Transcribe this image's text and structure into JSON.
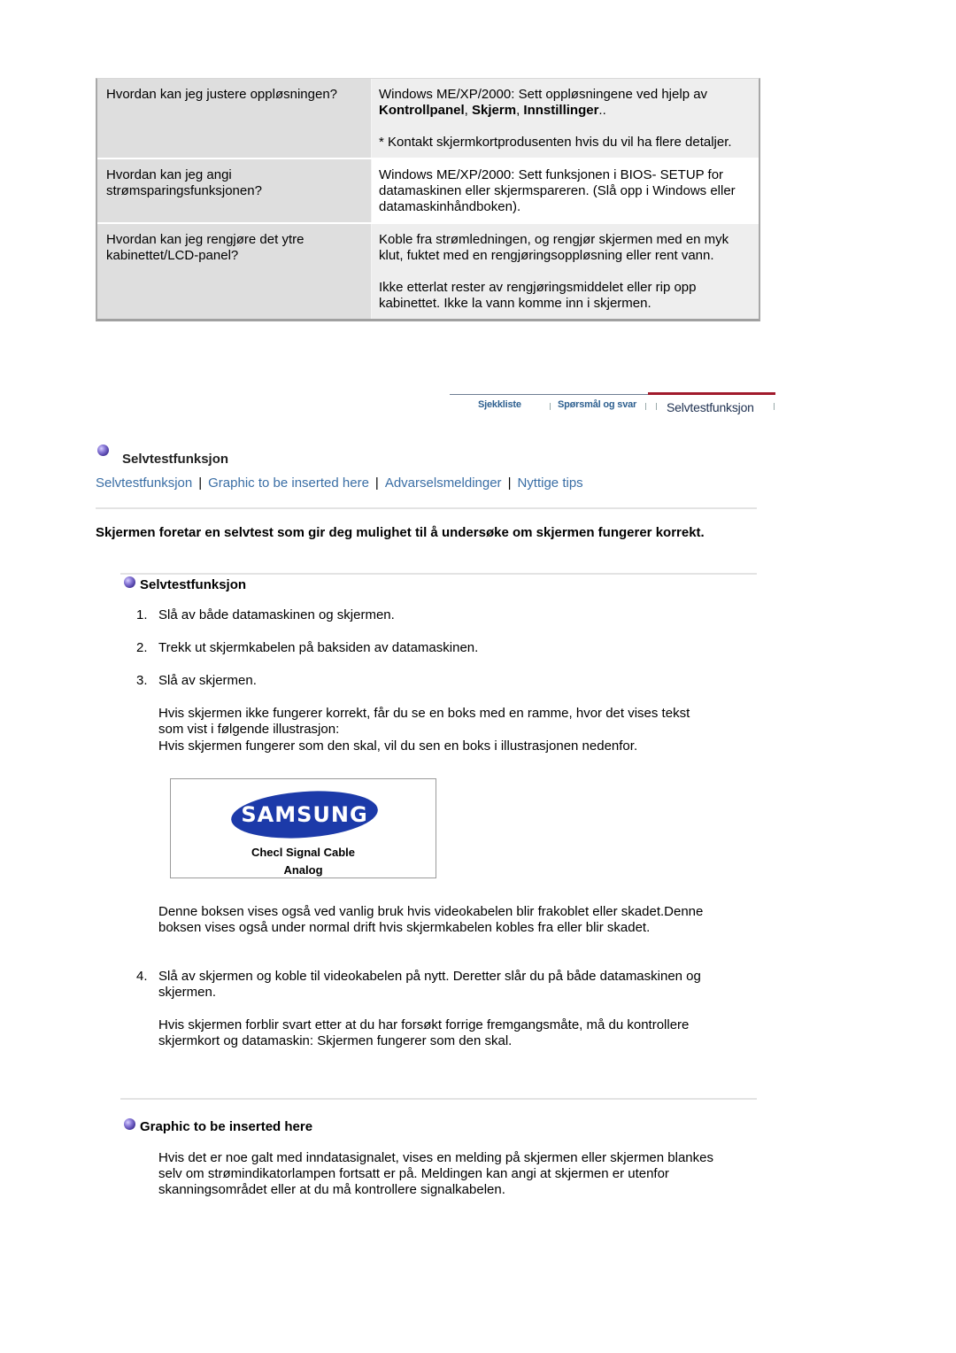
{
  "faq": [
    {
      "question": "Hvordan kan jeg justere oppløsningen?",
      "answer_prefix": "Windows ME/XP/2000: Sett oppløsningene ved hjelp av ",
      "answer_bold_1": "Kontrollpanel",
      "answer_sep_1": ", ",
      "answer_bold_2": "Skjerm",
      "answer_sep_2": ", ",
      "answer_bold_3": "Innstillinger",
      "answer_suffix": "..",
      "answer_note": "* Kontakt skjermkortprodusenten hvis du vil ha flere detaljer."
    },
    {
      "question": "Hvordan kan jeg angi strømsparingsfunksjonen?",
      "answer": "Windows ME/XP/2000: Sett funksjonen i BIOS- SETUP for datamaskinen eller skjermspareren. (Slå opp i Windows eller datamaskinhåndboken)."
    },
    {
      "question": "Hvordan kan jeg rengjøre det ytre kabinettet/LCD-panel?",
      "answer": "Koble fra strømledningen, og rengjør skjermen med en myk klut, fuktet med en rengjøringsoppløsning eller rent vann.",
      "answer_note": "Ikke etterlat rester av rengjøringsmiddelet eller rip opp kabinettet. Ikke la vann komme inn i skjermen."
    }
  ],
  "tabnav": {
    "tabs": [
      "Sjekkliste",
      "Spørsmål og svar",
      "Selvtestfunksjon"
    ],
    "active_index": 2,
    "active_color": "#a11a2c"
  },
  "section": {
    "title": "Selvtestfunksjon",
    "links": [
      "Selvtestfunksjon",
      "Graphic to be inserted here",
      "Advarselsmeldinger",
      "Nyttige tips"
    ],
    "link_separator": "|",
    "intro": "Skjermen foretar en selvtest som gir deg mulighet til å undersøke om skjermen fungerer korrekt."
  },
  "selftest": {
    "heading": "Selvtestfunksjon",
    "steps": [
      {
        "num": "1.",
        "text": "Slå av både datamaskinen og skjermen."
      },
      {
        "num": "2.",
        "text": "Trekk ut skjermkabelen på baksiden av datamaskinen."
      },
      {
        "num": "3.",
        "text": "Slå av skjermen."
      },
      {
        "num": "4.",
        "text": "Slå av skjermen og koble til videokabelen på nytt. Deretter slår du på både datamaskinen og skjermen."
      }
    ],
    "step3_para": "Hvis skjermen ikke fungerer korrekt, får du se en boks med en ramme, hvor det vises tekst som vist i følgende illustrasjon:",
    "step3_para2": "Hvis skjermen fungerer som den skal, vil du sen en boks i illustrasjonen nedenfor.",
    "illustration": {
      "logo_text": "SAMSUNG",
      "line1": "Checl Signal Cable",
      "line2": "Analog"
    },
    "after_illustration": "Denne boksen vises også ved vanlig bruk hvis videokabelen blir frakoblet eller skadet.Denne boksen vises også under normal drift hvis skjermkabelen kobles fra eller blir skadet.",
    "step4_para": "Hvis skjermen forblir svart etter at du har forsøkt forrige fremgangsmåte, må du kontrollere skjermkort og datamaskin: Skjermen fungerer som den skal."
  },
  "graphic": {
    "heading": "Graphic to be inserted here",
    "text": "Hvis det er noe galt med inndatasignalet, vises en melding på skjermen eller skjermen blankes selv om strømindikatorlampen fortsatt er på. Meldingen kan angi at skjermen er utenfor skanningsområdet eller at du må kontrollere signalkabelen."
  },
  "colors": {
    "link": "#3a6ea5",
    "question_bg": "#dedede",
    "answer_bg": "#eeeeee",
    "tab_active_bar": "#a11a2c",
    "samsung_blue": "#1c3aa9"
  }
}
